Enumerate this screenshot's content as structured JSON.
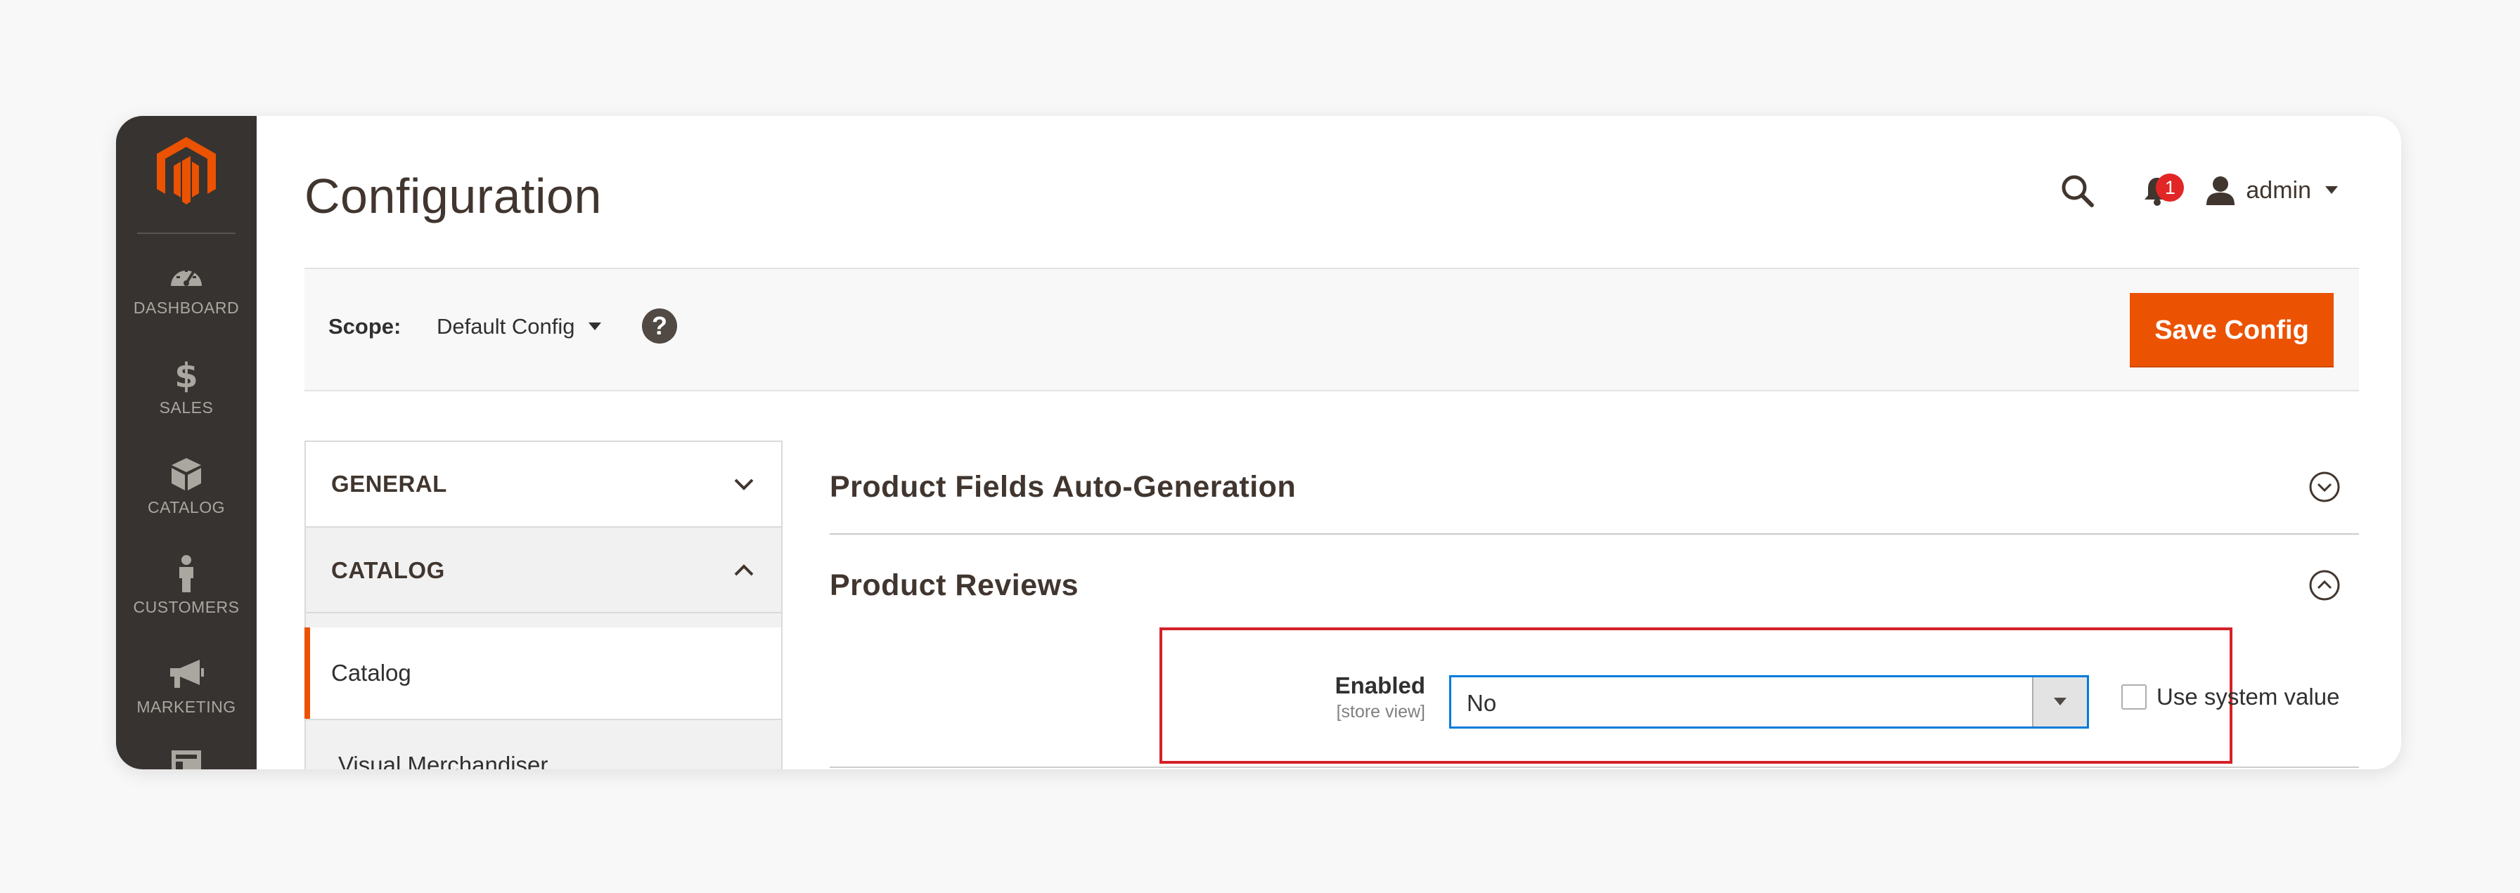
{
  "menu": {
    "items": [
      {
        "label": "DASHBOARD",
        "icon": "dashboard-icon"
      },
      {
        "label": "SALES",
        "icon": "dollar-icon"
      },
      {
        "label": "CATALOG",
        "icon": "box-icon"
      },
      {
        "label": "CUSTOMERS",
        "icon": "person-icon"
      },
      {
        "label": "MARKETING",
        "icon": "megaphone-icon"
      }
    ]
  },
  "header": {
    "title": "Configuration",
    "notifications_count": "1",
    "user_name": "admin"
  },
  "scope": {
    "label": "Scope:",
    "value": "Default Config",
    "help": "?",
    "save_label": "Save Config"
  },
  "config_nav": {
    "general": "GENERAL",
    "catalog": "CATALOG",
    "items": [
      "Catalog",
      "Visual Merchandiser"
    ]
  },
  "sections": {
    "autogen": "Product Fields Auto-Generation",
    "reviews": "Product Reviews"
  },
  "field": {
    "label": "Enabled",
    "scope": "[store view]",
    "value": "No",
    "system_value_label": "Use system value"
  },
  "colors": {
    "sidebar_bg": "#373330",
    "accent": "#eb5202",
    "highlight": "#d42129",
    "select_border": "#007bdb"
  }
}
